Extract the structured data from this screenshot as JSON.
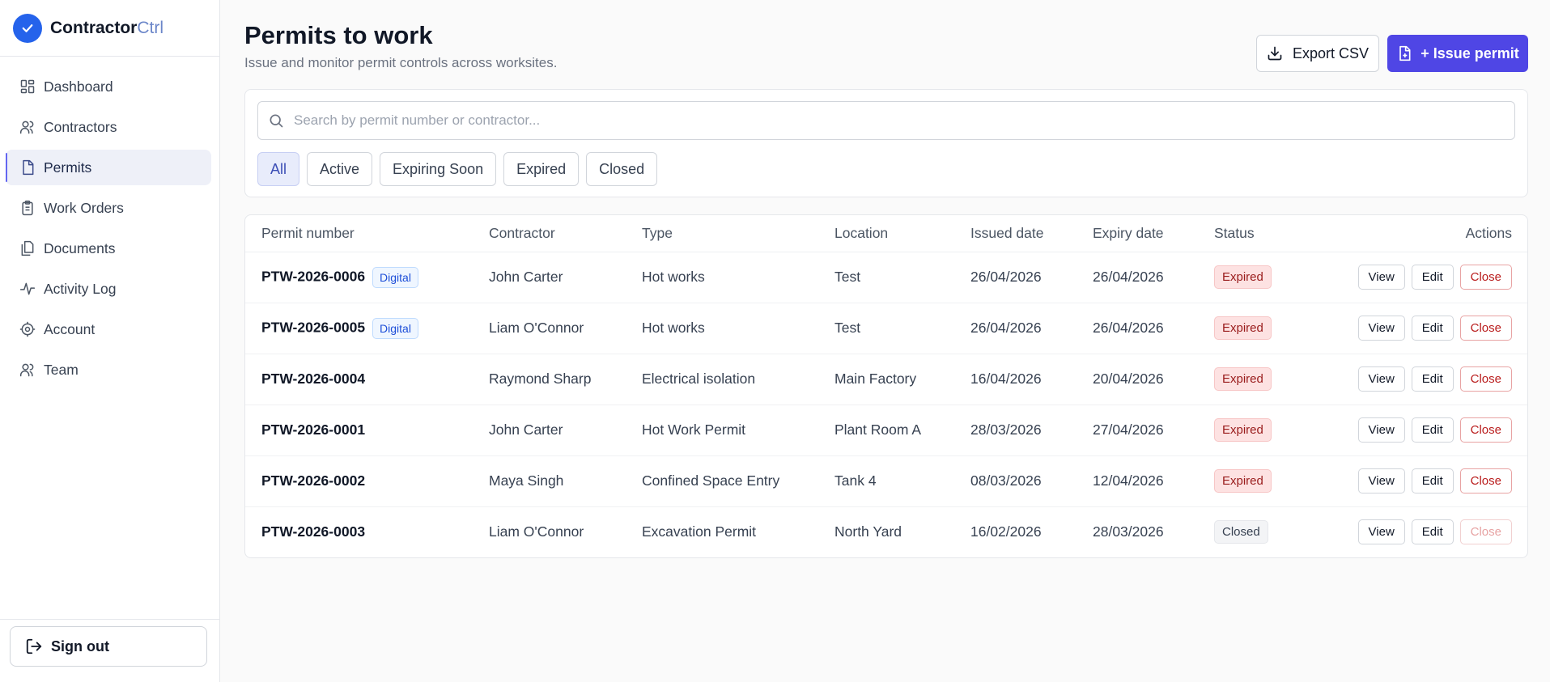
{
  "brand": {
    "name": "Contractor",
    "suffix": "Ctrl"
  },
  "sidebar": {
    "items": [
      {
        "label": "Dashboard",
        "icon": "dashboard-icon",
        "active": false
      },
      {
        "label": "Contractors",
        "icon": "users-icon",
        "active": false
      },
      {
        "label": "Permits",
        "icon": "file-icon",
        "active": true
      },
      {
        "label": "Work Orders",
        "icon": "clipboard-icon",
        "active": false
      },
      {
        "label": "Documents",
        "icon": "documents-icon",
        "active": false
      },
      {
        "label": "Activity Log",
        "icon": "activity-icon",
        "active": false
      },
      {
        "label": "Account",
        "icon": "gear-icon",
        "active": false
      },
      {
        "label": "Team",
        "icon": "team-icon",
        "active": false
      }
    ],
    "signout_label": "Sign out"
  },
  "page": {
    "title": "Permits to work",
    "subtitle": "Issue and monitor permit controls across worksites."
  },
  "toolbar": {
    "export_label": "Export CSV",
    "issue_label": "+ Issue permit"
  },
  "search": {
    "placeholder": "Search by permit number or contractor...",
    "value": ""
  },
  "filters": [
    {
      "label": "All",
      "active": true
    },
    {
      "label": "Active",
      "active": false
    },
    {
      "label": "Expiring Soon",
      "active": false
    },
    {
      "label": "Expired",
      "active": false
    },
    {
      "label": "Closed",
      "active": false
    }
  ],
  "table": {
    "columns": [
      "Permit number",
      "Contractor",
      "Type",
      "Location",
      "Issued date",
      "Expiry date",
      "Status",
      "Actions"
    ],
    "rows": [
      {
        "permit": "PTW-2026-0006",
        "badge": "Digital",
        "contractor": "John Carter",
        "type": "Hot works",
        "location": "Test",
        "issued": "26/04/2026",
        "expiry": "26/04/2026",
        "status": "Expired",
        "status_kind": "expired",
        "close_enabled": true
      },
      {
        "permit": "PTW-2026-0005",
        "badge": "Digital",
        "contractor": "Liam O'Connor",
        "type": "Hot works",
        "location": "Test",
        "issued": "26/04/2026",
        "expiry": "26/04/2026",
        "status": "Expired",
        "status_kind": "expired",
        "close_enabled": true
      },
      {
        "permit": "PTW-2026-0004",
        "badge": "",
        "contractor": "Raymond Sharp",
        "type": "Electrical isolation",
        "location": "Main Factory",
        "issued": "16/04/2026",
        "expiry": "20/04/2026",
        "status": "Expired",
        "status_kind": "expired",
        "close_enabled": true
      },
      {
        "permit": "PTW-2026-0001",
        "badge": "",
        "contractor": "John Carter",
        "type": "Hot Work Permit",
        "location": "Plant Room A",
        "issued": "28/03/2026",
        "expiry": "27/04/2026",
        "status": "Expired",
        "status_kind": "expired",
        "close_enabled": true
      },
      {
        "permit": "PTW-2026-0002",
        "badge": "",
        "contractor": "Maya Singh",
        "type": "Confined Space Entry",
        "location": "Tank 4",
        "issued": "08/03/2026",
        "expiry": "12/04/2026",
        "status": "Expired",
        "status_kind": "expired",
        "close_enabled": true
      },
      {
        "permit": "PTW-2026-0003",
        "badge": "",
        "contractor": "Liam O'Connor",
        "type": "Excavation Permit",
        "location": "North Yard",
        "issued": "16/02/2026",
        "expiry": "28/03/2026",
        "status": "Closed",
        "status_kind": "closed",
        "close_enabled": false
      }
    ],
    "actions": {
      "view": "View",
      "edit": "Edit",
      "close": "Close"
    }
  },
  "colors": {
    "accent": "#4f46e5",
    "brand": "#2563eb",
    "expired_bg": "#fde2e2",
    "expired_text": "#991b1b",
    "digital_text": "#1d4ed8"
  }
}
